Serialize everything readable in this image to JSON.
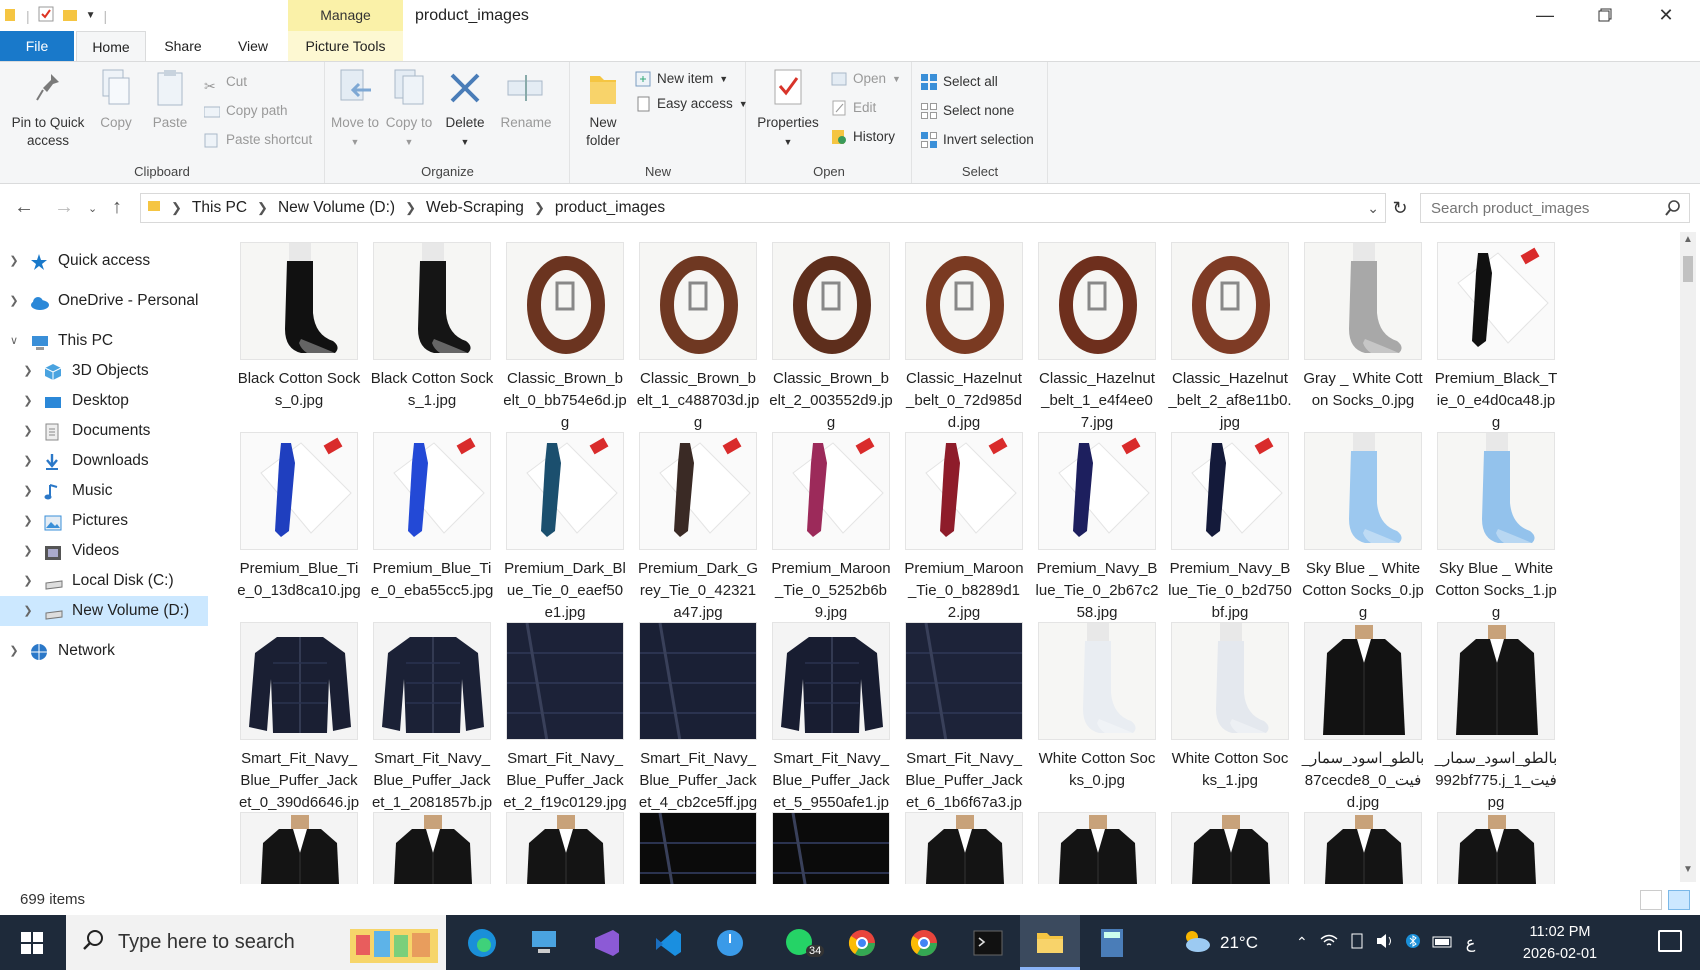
{
  "window": {
    "title": "product_images",
    "context_tab": "Manage",
    "controls": [
      "minimize",
      "restore",
      "close"
    ]
  },
  "tabs": {
    "file": "File",
    "home": "Home",
    "share": "Share",
    "view": "View",
    "picture_tools": "Picture Tools"
  },
  "ribbon": {
    "clipboard": {
      "label": "Clipboard",
      "pin": "Pin to Quick access",
      "copy": "Copy",
      "paste": "Paste",
      "cut": "Cut",
      "copy_path": "Copy path",
      "paste_shortcut": "Paste shortcut"
    },
    "organize": {
      "label": "Organize",
      "move_to": "Move to",
      "copy_to": "Copy to",
      "delete": "Delete",
      "rename": "Rename"
    },
    "new": {
      "label": "New",
      "new_folder": "New folder",
      "new_item": "New item",
      "easy_access": "Easy access"
    },
    "open": {
      "label": "Open",
      "properties": "Properties",
      "open": "Open",
      "edit": "Edit",
      "history": "History"
    },
    "select": {
      "label": "Select",
      "select_all": "Select all",
      "select_none": "Select none",
      "invert_selection": "Invert selection"
    }
  },
  "address": {
    "crumbs": [
      "This PC",
      "New Volume (D:)",
      "Web-Scraping",
      "product_images"
    ],
    "search_placeholder": "Search product_images"
  },
  "nav": [
    {
      "label": "Quick access",
      "icon": "star-icon",
      "color": "#1979ca",
      "expandable": true,
      "expanded": false
    },
    {
      "label": "OneDrive - Personal",
      "icon": "cloud-icon",
      "color": "#2b88d8",
      "expandable": true,
      "expanded": false
    },
    {
      "label": "This PC",
      "icon": "pc-icon",
      "color": "#3a8fd8",
      "expandable": true,
      "expanded": true
    },
    {
      "label": "3D Objects",
      "icon": "cube-icon",
      "color": "#4aa3e0",
      "expandable": true,
      "expanded": false,
      "child": true
    },
    {
      "label": "Desktop",
      "icon": "desktop-icon",
      "color": "#2b88d8",
      "expandable": true,
      "expanded": false,
      "child": true
    },
    {
      "label": "Documents",
      "icon": "document-icon",
      "color": "#888888",
      "expandable": true,
      "expanded": false,
      "child": true
    },
    {
      "label": "Downloads",
      "icon": "download-icon",
      "color": "#2b78c8",
      "expandable": true,
      "expanded": false,
      "child": true
    },
    {
      "label": "Music",
      "icon": "music-icon",
      "color": "#2b78c8",
      "expandable": true,
      "expanded": false,
      "child": true
    },
    {
      "label": "Pictures",
      "icon": "pictures-icon",
      "color": "#3a8fd8",
      "expandable": true,
      "expanded": false,
      "child": true
    },
    {
      "label": "Videos",
      "icon": "videos-icon",
      "color": "#555555",
      "expandable": true,
      "expanded": false,
      "child": true
    },
    {
      "label": "Local Disk (C:)",
      "icon": "drive-icon",
      "color": "#777777",
      "expandable": true,
      "expanded": false,
      "child": true
    },
    {
      "label": "New Volume (D:)",
      "icon": "drive-icon",
      "color": "#777777",
      "expandable": true,
      "expanded": false,
      "child": true,
      "selected": true
    },
    {
      "label": "Network",
      "icon": "network-icon",
      "color": "#2b78c8",
      "expandable": true,
      "expanded": false
    }
  ],
  "files": [
    {
      "name": "Black Cotton Socks_0.jpg",
      "kind": "sock",
      "color": "#111111"
    },
    {
      "name": "Black Cotton Socks_1.jpg",
      "kind": "sock",
      "color": "#151515"
    },
    {
      "name": "Classic_Brown_belt_0_bb754e6d.jpg",
      "kind": "belt",
      "color": "#6b3420"
    },
    {
      "name": "Classic_Brown_belt_1_c488703d.jpg",
      "kind": "belt",
      "color": "#6f3822"
    },
    {
      "name": "Classic_Brown_belt_2_003552d9.jpg",
      "kind": "belt",
      "color": "#5e2e1c"
    },
    {
      "name": "Classic_Hazelnut_belt_0_72d985dd.jpg",
      "kind": "belt",
      "color": "#7a3a22"
    },
    {
      "name": "Classic_Hazelnut_belt_1_e4f4ee07.jpg",
      "kind": "belt",
      "color": "#6e2f1d"
    },
    {
      "name": "Classic_Hazelnut_belt_2_af8e11b0.jpg",
      "kind": "belt",
      "color": "#7e3b25"
    },
    {
      "name": "Gray _ White Cotton Socks_0.jpg",
      "kind": "sock",
      "color": "#a8a8a8"
    },
    {
      "name": "Premium_Black_Tie_0_e4d0ca48.jpg",
      "kind": "tie",
      "color": "#111111"
    },
    {
      "name": "Premium_Blue_Tie_0_13d8ca10.jpg",
      "kind": "tie",
      "color": "#1f3fbf"
    },
    {
      "name": "Premium_Blue_Tie_0_eba55cc5.jpg",
      "kind": "tie",
      "color": "#2349d6"
    },
    {
      "name": "Premium_Dark_Blue_Tie_0_eaef50e1.jpg",
      "kind": "tie",
      "color": "#1b4f6e"
    },
    {
      "name": "Premium_Dark_Grey_Tie_0_42321a47.jpg",
      "kind": "tie",
      "color": "#3a2a25"
    },
    {
      "name": "Premium_Maroon_Tie_0_5252b6b9.jpg",
      "kind": "tie",
      "color": "#9c2a5a"
    },
    {
      "name": "Premium_Maroon_Tie_0_b8289d12.jpg",
      "kind": "tie",
      "color": "#8e1c2a"
    },
    {
      "name": "Premium_Navy_Blue_Tie_0_2b67c258.jpg",
      "kind": "tie",
      "color": "#1d1f5e"
    },
    {
      "name": "Premium_Navy_Blue_Tie_0_b2d750bf.jpg",
      "kind": "tie",
      "color": "#141a3a"
    },
    {
      "name": "Sky Blue _ White Cotton Socks_0.jpg",
      "kind": "sock",
      "color": "#9cc8ef"
    },
    {
      "name": "Sky Blue _ White Cotton Socks_1.jpg",
      "kind": "sock",
      "color": "#93c2ec"
    },
    {
      "name": "Smart_Fit_Navy_Blue_Puffer_Jacket_0_390d6646.jpg",
      "kind": "jacket",
      "color": "#1a1f33"
    },
    {
      "name": "Smart_Fit_Navy_Blue_Puffer_Jacket_1_2081857b.jpg",
      "kind": "jacket",
      "color": "#1b2136"
    },
    {
      "name": "Smart_Fit_Navy_Blue_Puffer_Jacket_2_f19c0129.jpg",
      "kind": "jacketclose",
      "color": "#1c2238"
    },
    {
      "name": "Smart_Fit_Navy_Blue_Puffer_Jacket_4_cb2ce5ff.jpg",
      "kind": "jacketclose",
      "color": "#1a2035"
    },
    {
      "name": "Smart_Fit_Navy_Blue_Puffer_Jacket_5_9550afe1.jpg",
      "kind": "jacket",
      "color": "#181d31"
    },
    {
      "name": "Smart_Fit_Navy_Blue_Puffer_Jacket_6_1b6f67a3.jpg",
      "kind": "jacketclose",
      "color": "#1d2339"
    },
    {
      "name": "White Cotton Socks_0.jpg",
      "kind": "sock",
      "color": "#e9edf2"
    },
    {
      "name": "White Cotton Socks_1.jpg",
      "kind": "sock",
      "color": "#e4e8ee"
    },
    {
      "name": "بالطو_اسود_سمار_فيت_0_87cecde8d.jpg",
      "kind": "coat",
      "color": "#121212"
    },
    {
      "name": "بالطو_اسود_سمار_فيت_1_992bf775.jpg",
      "kind": "coat",
      "color": "#141414"
    }
  ],
  "status": {
    "item_count": "699 items"
  },
  "taskbar": {
    "search_placeholder": "Type here to search",
    "weather": "21°C",
    "badge": "34",
    "ime": "ع",
    "time": "11:02 PM",
    "date": "2026-02-01"
  }
}
